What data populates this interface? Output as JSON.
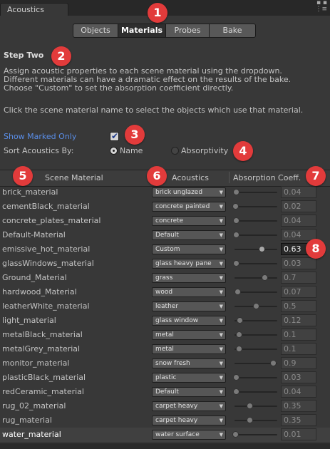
{
  "window": {
    "tab_title": "Acoustics",
    "menu_icon": "kebab-menu-icon"
  },
  "toolbar": {
    "tabs": [
      {
        "label": "Objects",
        "active": false
      },
      {
        "label": "Materials",
        "active": true
      },
      {
        "label": "Probes",
        "active": false
      },
      {
        "label": "Bake",
        "active": false
      }
    ]
  },
  "intro": {
    "heading": "Step Two",
    "desc_1": "Assign acoustic properties to each scene material using the dropdown.",
    "desc_2": "Different materials can have a dramatic effect on the results of the bake.",
    "desc_3": "Choose \"Custom\" to set the absorption coefficient directly.",
    "hint": "Click the scene material name to select the objects which use that material."
  },
  "options": {
    "show_marked_label": "Show Marked Only",
    "show_marked_checked": true,
    "sort_label": "Sort Acoustics By:",
    "sort_name": "Name",
    "sort_absorptivity": "Absorptivity",
    "sort_selected": "Name"
  },
  "table": {
    "headers": {
      "material": "Scene Material",
      "acoustics": "Acoustics",
      "coeff": "Absorption Coeff."
    },
    "rows": [
      {
        "material": "brick_material",
        "acoustics": "brick unglazed",
        "coeff": "0.04",
        "level": 0.04
      },
      {
        "material": "cementBlack_material",
        "acoustics": "concrete painted",
        "coeff": "0.02",
        "level": 0.02
      },
      {
        "material": "concrete_plates_material",
        "acoustics": "concrete",
        "coeff": "0.04",
        "level": 0.04
      },
      {
        "material": "Default-Material",
        "acoustics": "Default",
        "coeff": "0.04",
        "level": 0.04
      },
      {
        "material": "emissive_hot_material",
        "acoustics": "Custom",
        "coeff": "0.63",
        "level": 0.63
      },
      {
        "material": "glassWindows_material",
        "acoustics": "glass heavy pane",
        "coeff": "0.03",
        "level": 0.03
      },
      {
        "material": "Ground_Material",
        "acoustics": "grass",
        "coeff": "0.7",
        "level": 0.7
      },
      {
        "material": "hardwood_Material",
        "acoustics": "wood",
        "coeff": "0.07",
        "level": 0.07
      },
      {
        "material": "leatherWhite_material",
        "acoustics": "leather",
        "coeff": "0.5",
        "level": 0.5
      },
      {
        "material": "light_material",
        "acoustics": "glass window",
        "coeff": "0.12",
        "level": 0.12
      },
      {
        "material": "metalBlack_material",
        "acoustics": "metal",
        "coeff": "0.1",
        "level": 0.1
      },
      {
        "material": "metalGrey_material",
        "acoustics": "metal",
        "coeff": "0.1",
        "level": 0.1
      },
      {
        "material": "monitor_material",
        "acoustics": "snow fresh",
        "coeff": "0.9",
        "level": 0.9
      },
      {
        "material": "plasticBlack_material",
        "acoustics": "plastic",
        "coeff": "0.03",
        "level": 0.03
      },
      {
        "material": "redCeramic_material",
        "acoustics": "Default",
        "coeff": "0.04",
        "level": 0.04
      },
      {
        "material": "rug_02_material",
        "acoustics": "carpet heavy",
        "coeff": "0.35",
        "level": 0.35
      },
      {
        "material": "rug_material",
        "acoustics": "carpet heavy",
        "coeff": "0.35",
        "level": 0.35
      },
      {
        "material": "water_material",
        "acoustics": "water surface",
        "coeff": "0.01",
        "level": 0.01
      }
    ]
  },
  "annotations": [
    "1",
    "2",
    "3",
    "4",
    "5",
    "6",
    "7",
    "8"
  ],
  "colors": {
    "background": "#383838",
    "badge": "#e23b3b",
    "link_blue": "#5a8ee8"
  }
}
